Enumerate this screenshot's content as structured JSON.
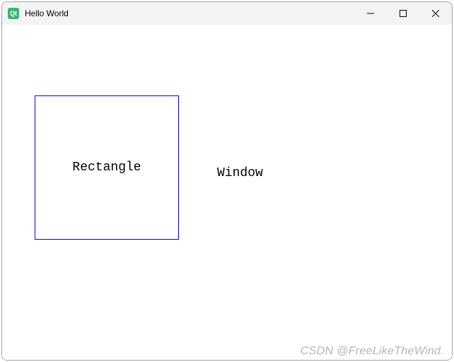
{
  "titlebar": {
    "title": "Hello World",
    "icon_name": "qt-app-icon"
  },
  "controls": {
    "minimize_name": "minimize-button",
    "maximize_name": "maximize-button",
    "close_name": "close-button"
  },
  "content": {
    "rectangle_label": "Rectangle",
    "window_label": "Window"
  },
  "watermark": {
    "text": "CSDN @FreeLikeTheWind."
  }
}
